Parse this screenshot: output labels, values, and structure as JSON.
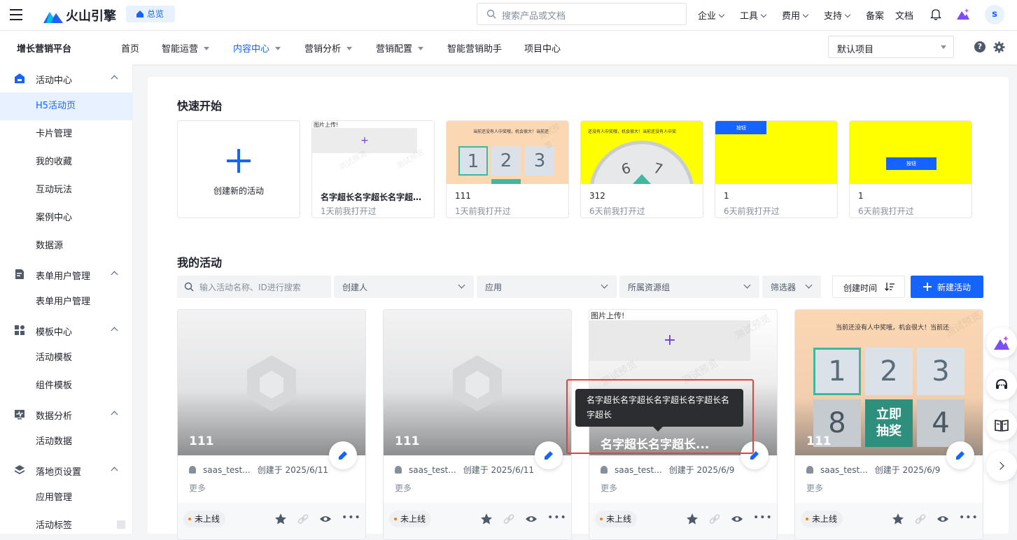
{
  "topbar": {
    "brand": "火山引擎",
    "home_badge": "总览",
    "search_placeholder": "搜索产品或文档",
    "nav": [
      "企业",
      "工具",
      "费用",
      "支持",
      "备案",
      "文档"
    ],
    "avatar_letter": "s"
  },
  "subnav": {
    "platform": "增长营销平台",
    "items": [
      "首页",
      "智能运营",
      "内容中心",
      "营销分析",
      "营销配置",
      "智能营销助手",
      "项目中心"
    ],
    "project_select": "默认项目"
  },
  "sidebar": {
    "groups": [
      {
        "label": "活动中心",
        "items": [
          "H5活动页",
          "卡片管理",
          "我的收藏",
          "互动玩法",
          "案例中心",
          "数据源"
        ]
      },
      {
        "label": "表单用户管理",
        "items": [
          "表单用户管理"
        ]
      },
      {
        "label": "模板中心",
        "items": [
          "活动模板",
          "组件模板"
        ]
      },
      {
        "label": "数据分析",
        "items": [
          "活动数据"
        ]
      },
      {
        "label": "落地页设置",
        "items": [
          "应用管理",
          "活动标签"
        ]
      }
    ]
  },
  "quick_start": {
    "title": "快速开始",
    "create_label": "创建新的活动",
    "cards": [
      {
        "name": "名字超长名字超长名字超长...",
        "time": "1天前我打开过",
        "thumb_text": "图片上传!"
      },
      {
        "name": "111",
        "time": "1天前我打开过",
        "thumb_text": "当前还没有人中奖哦，机会很大！当前还"
      },
      {
        "name": "312",
        "time": "6天前我打开过",
        "thumb_text": "还没有人中奖哦，机会很大！当前还没有人中奖"
      },
      {
        "name": "1",
        "time": "6天前我打开过",
        "thumb_text": "按钮"
      },
      {
        "name": "1",
        "time": "6天前我打开过",
        "thumb_text": "按钮"
      }
    ],
    "watermark": "测试预览"
  },
  "my_activities": {
    "title": "我的活动",
    "search_placeholder": "输入活动名称、ID进行搜索",
    "filters": [
      "创建人",
      "应用",
      "所属资源组",
      "筛选器"
    ],
    "sort_label": "创建时间",
    "new_button": "新建活动",
    "more_label": "更多",
    "status_label": "未上线",
    "cards": [
      {
        "title": "111",
        "owner": "saas_test...",
        "created": "创建于 2025/6/11"
      },
      {
        "title": "111",
        "owner": "saas_test...",
        "created": "创建于 2025/6/11"
      },
      {
        "title": "名字超长名字超长...",
        "owner": "saas_test...",
        "created": "创建于 2025/6/9",
        "thumb_text": "图片上传!"
      },
      {
        "title": "111",
        "owner": "saas_test...",
        "created": "创建于 2025/6/9",
        "thumb_text": "当前还没有人中奖哦，机会很大！当前还",
        "draw_label": "立即抽奖"
      }
    ],
    "tooltip": "名字超长名字超长名字超长名字超长名字超长",
    "lottery_numbers": [
      "1",
      "2",
      "3",
      "8",
      "4"
    ],
    "wheel_numbers": [
      "6",
      "7"
    ]
  },
  "colors": {
    "accent": "#1664ff",
    "highlight_box": "#e8413a",
    "yellow": "#ffff00"
  }
}
